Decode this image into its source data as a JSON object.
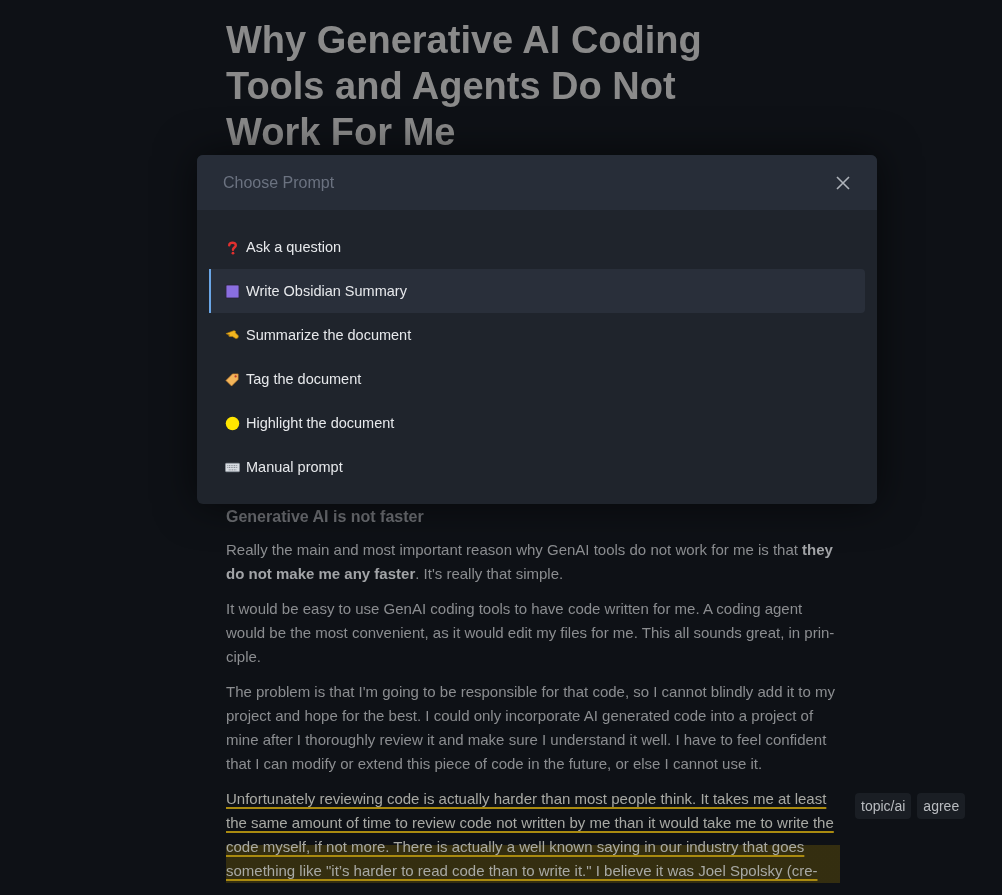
{
  "article": {
    "title": "Why Generative AI Coding Tools and Agents Do Not Work For Me",
    "section_heading": "Generative AI is not faster",
    "paragraphs": [
      {
        "text": "Really the main and most important reason why GenAI tools do not work for me is that **they do not make me any faster**. It's really that simple.",
        "highlighted": false
      },
      {
        "text": "It would be easy to use GenAI coding tools to have code written for me. A coding agent would be the most convenient, as it would edit my files for me. This all sounds great, in prin-ciple.",
        "highlighted": false
      },
      {
        "text": "The problem is that I'm going to be responsible for that code, so I cannot blindly add it to my project and hope for the best. I could only incorporate AI generated code into a project of mine after I thoroughly review it and make sure I understand it well. I have to feel confident that I can modify or extend this piece of code in the future, or else I cannot use it.",
        "highlighted": false
      },
      {
        "text": "Unfortunately reviewing code is actually harder than most people think. It takes me at least the same amount of time to review code not written by me than it would take me to write the code myself, if not more. There is actually a well known saying in our industry that goes something like \"it’s harder to read code than to write it.\" I believe it was Joel Spolsky (cre-",
        "highlighted": true,
        "tags": [
          "topic/ai",
          "agree"
        ]
      }
    ]
  },
  "modal": {
    "title": "Choose Prompt",
    "items": [
      {
        "kind": "question",
        "label": "Ask a question",
        "selected": false
      },
      {
        "kind": "square",
        "label": "Write Obsidian Summary",
        "selected": true
      },
      {
        "kind": "hand",
        "label": "Summarize the document",
        "selected": false
      },
      {
        "kind": "tag",
        "label": "Tag the document",
        "selected": false
      },
      {
        "kind": "circle",
        "label": "Highlight the document",
        "selected": false
      },
      {
        "kind": "keyboard",
        "label": "Manual prompt",
        "selected": false
      }
    ]
  }
}
